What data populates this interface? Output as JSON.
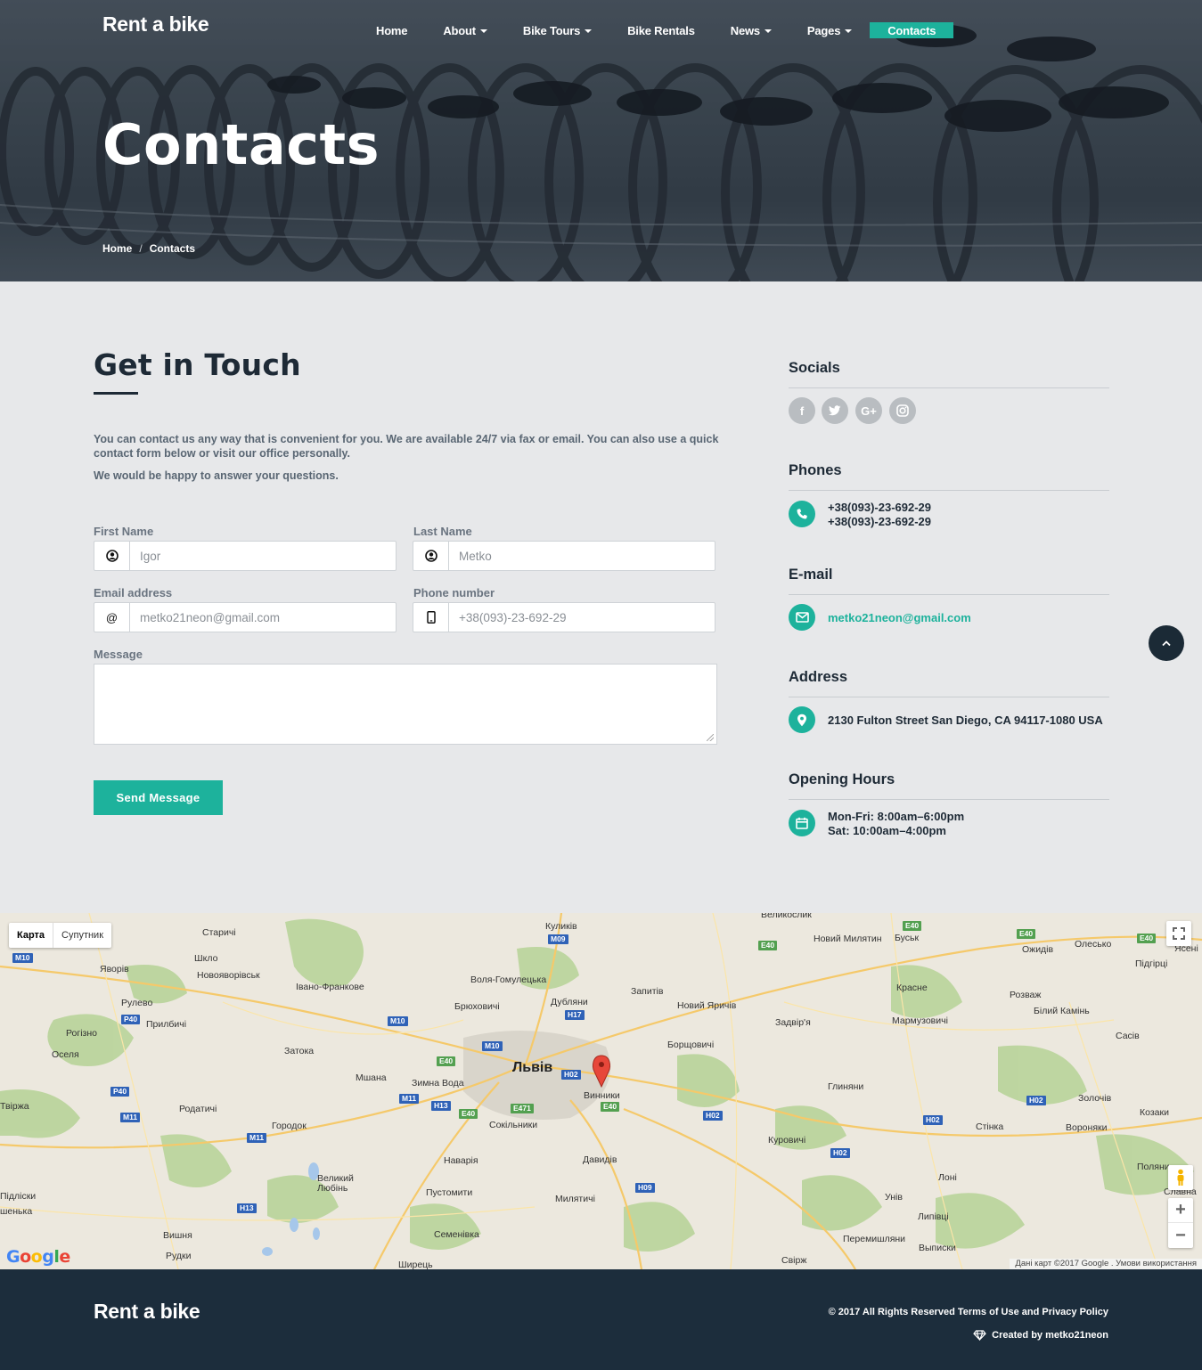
{
  "header": {
    "brand": "Rent a bike",
    "nav": [
      {
        "label": "Home",
        "dropdown": false
      },
      {
        "label": "About",
        "dropdown": true
      },
      {
        "label": "Bike Tours",
        "dropdown": true
      },
      {
        "label": "Bike Rentals",
        "dropdown": false
      },
      {
        "label": "News",
        "dropdown": true
      },
      {
        "label": "Pages",
        "dropdown": true
      },
      {
        "label": "Contacts",
        "dropdown": false,
        "active": true
      }
    ],
    "page_title": "Contacts",
    "breadcrumb": {
      "home": "Home",
      "sep": "/",
      "current": "Contacts"
    }
  },
  "contact": {
    "title": "Get in Touch",
    "intro": "You can contact us any way that is convenient for you. We are available 24/7 via fax or email. You can also use a quick contact form below or visit our office personally.",
    "intro2": "We would be happy to answer your questions.",
    "form": {
      "first_name_label": "First Name",
      "first_name_placeholder": "Igor",
      "last_name_label": "Last Name",
      "last_name_placeholder": "Metko",
      "email_label": "Email address",
      "email_placeholder": "metko21neon@gmail.com",
      "email_addon": "@",
      "phone_label": "Phone number",
      "phone_placeholder": "+38(093)-23-692-29",
      "message_label": "Message",
      "submit_label": "Send Message"
    }
  },
  "sidebar": {
    "socials_title": "Socials",
    "social_icons": [
      "facebook-icon",
      "twitter-icon",
      "google-plus-icon",
      "instagram-icon"
    ],
    "social_glyphs": {
      "facebook": "f",
      "google_plus": "G+"
    },
    "phones_title": "Phones",
    "phone1": "+38(093)-23-692-29",
    "phone2": "+38(093)-23-692-29",
    "email_title": "E-mail",
    "email": "metko21neon@gmail.com",
    "address_title": "Address",
    "address": "2130 Fulton Street San Diego, CA 94117-1080 USA",
    "hours_title": "Opening Hours",
    "hours1": "Mon-Fri: 8:00am–6:00pm",
    "hours2": "Sat: 10:00am–4:00pm"
  },
  "map": {
    "type_map": "Карта",
    "type_satellite": "Супутник",
    "logo": "Google",
    "credit": "Дані карт ©2017 Google  .  Умови використання",
    "zoom_in": "+",
    "zoom_out": "−",
    "labels": {
      "lviv": "Львів",
      "vynnyky": "Винники",
      "starychi": "Старичі",
      "kulykiv": "Куликів",
      "novyi_myliatyn": "Новий Милятин",
      "busk": "Буськ",
      "olesko": "Олесько",
      "ozhydiv": "Ожидів",
      "pidhirtsi": "Підгірці",
      "yavoriv": "Яворів",
      "shklo": "Шкло",
      "novoiavorivsk": "Новояворівськ",
      "ivano_frankove": "Івано-Франкове",
      "volia": "Воля-Гомулецька",
      "zapytiv": "Запитів",
      "krasne": "Красне",
      "rozvazh": "Розваж",
      "bilyi_kamin": "Білий Камінь",
      "rulevo": "Рулево",
      "prylbychi": "Прилбичі",
      "briukhovychi": "Брюховичі",
      "dubliany": "Дубляни",
      "novyi_iarychiv": "Новий Яричів",
      "zadvirya": "Задвір'я",
      "marmuzovychi": "Мармузовичі",
      "rohizno": "Рогізно",
      "sasiv": "Сасів",
      "oselia": "Оселя",
      "zatoka": "Затока",
      "borshchovychi": "Борщовичі",
      "mshana": "Мшана",
      "zymna_voda": "Зимна Вода",
      "hlyniany": "Глиняни",
      "tvirzha": "Твіржа",
      "rodatychi": "Родатичі",
      "horodok": "Городок",
      "sokilnyky": "Сокільники",
      "zolochiv": "Золочів",
      "kozaky": "Козаки",
      "voroniaky": "Вороняки",
      "kurovychi": "Куровичі",
      "stinka": "Стінка",
      "naviria": "Наварія",
      "davydiv": "Давидів",
      "velykyi_liubin": "Великий Любінь",
      "pustomyty": "Пустомити",
      "loni": "Лоні",
      "poliany": "Поляни",
      "slavna": "Славна",
      "pidliski": "Підліски",
      "shenka": "шенька",
      "univ": "Унів",
      "mylyatychi": "Милятичі",
      "lypivtsi": "Липівці",
      "semenivka": "Семенівка",
      "vyshnia": "Вишня",
      "rudky": "Рудки",
      "peremyshliany": "Перемишляни",
      "vypysky": "Выписки",
      "svirzh": "Свірж",
      "shyrets": "Ширець",
      "velykoslyk": "Великослик",
      "yaseni": "Ясені"
    },
    "shields": {
      "m09": "M09",
      "m10": "M10",
      "m11": "M11",
      "h17": "H17",
      "h02": "H02",
      "h13": "H13",
      "h09": "H09",
      "e40": "E40",
      "e471": "E471",
      "p40": "P40"
    }
  },
  "footer": {
    "brand": "Rent a bike",
    "copyright": "© 2017 All Rights Reserved Terms of Use and Privacy Policy",
    "created": "Created by metko21neon"
  },
  "colors": {
    "accent": "#1db29c",
    "dark": "#1c2d3c",
    "background": "#e7e8ea"
  }
}
